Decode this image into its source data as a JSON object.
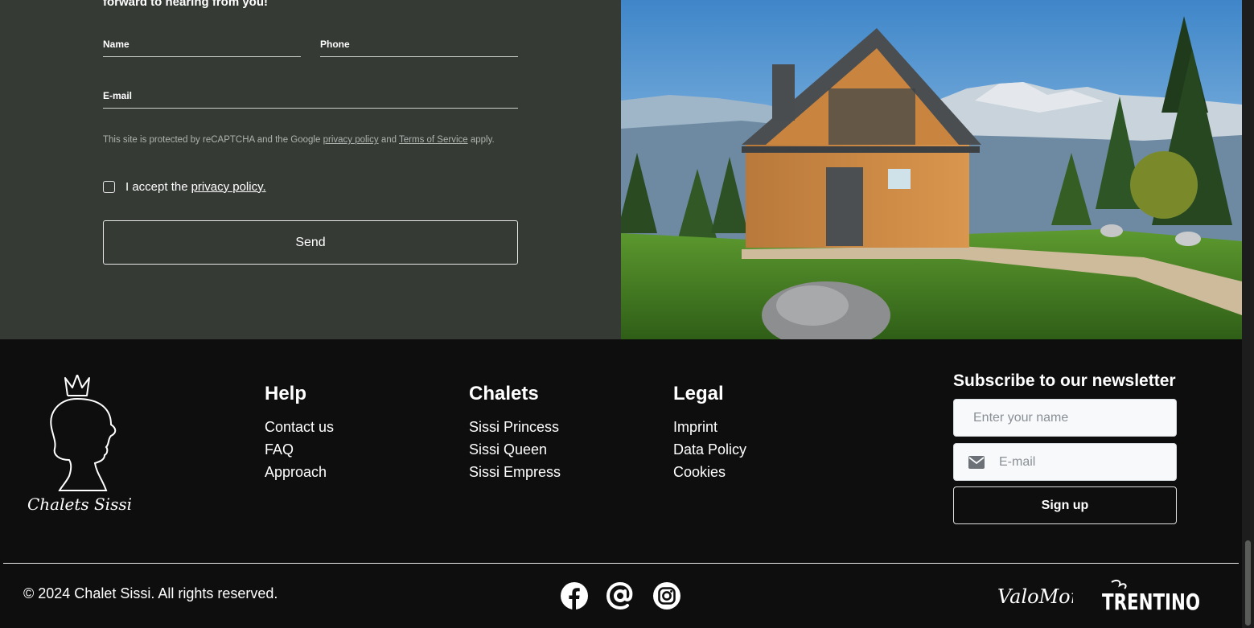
{
  "contact": {
    "intro_tail": "forward to hearing from you!",
    "name_label": "Name",
    "phone_label": "Phone",
    "email_label": "E-mail",
    "recaptcha_text_1": "This site is protected by reCAPTCHA and the Google",
    "recaptcha_privacy": "privacy policy",
    "recaptcha_and": "and",
    "recaptcha_terms": "Terms of Service",
    "recaptcha_apply": "apply.",
    "consent_text": "I accept the",
    "consent_link": "privacy policy.",
    "send_label": "Send"
  },
  "footer": {
    "logo_text": "Chalets Sissi",
    "columns": [
      {
        "title": "Help",
        "links": [
          "Contact us",
          "FAQ",
          "Approach"
        ]
      },
      {
        "title": "Chalets",
        "links": [
          "Sissi Princess",
          "Sissi Queen",
          "Sissi Empress"
        ]
      },
      {
        "title": "Legal",
        "links": [
          "Imprint",
          "Data Policy",
          "Cookies"
        ]
      }
    ],
    "newsletter": {
      "title": "Subscribe to our newsletter",
      "name_placeholder": "Enter your name",
      "email_placeholder": "E-mail",
      "signup_label": "Sign up"
    },
    "copyright": "© 2024 Chalet Sissi. All rights reserved.",
    "social_icons": [
      "facebook-icon",
      "at-sign-icon",
      "instagram-icon"
    ],
    "partners": [
      "ValoMon",
      "TRENTINO"
    ]
  },
  "colors": {
    "contact_bg": "#353a35",
    "footer_bg": "#0d0e0d",
    "text": "#ffffff",
    "input_bg": "#f8f9fa"
  }
}
